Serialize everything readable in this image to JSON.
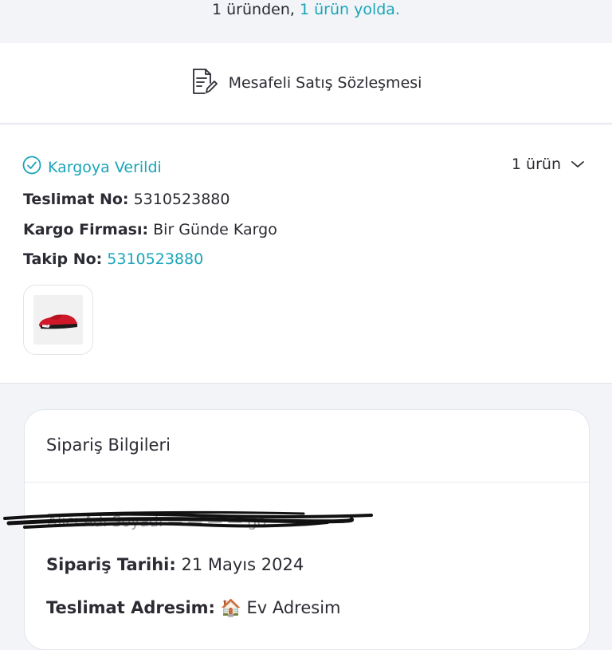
{
  "banner": {
    "count_text": "1 üründen,",
    "status_text": "1 ürün yolda."
  },
  "contract": {
    "label": "Mesafeli Satış Sözleşmesi",
    "icon": "document-edit-icon"
  },
  "shipment": {
    "status": "Kargoya Verildi",
    "status_icon": "check-circle-icon",
    "item_count": "1 ürün",
    "delivery_no_label": "Teslimat No:",
    "delivery_no": "5310523880",
    "carrier_label": "Kargo Firması:",
    "carrier": "Bir Günde Kargo",
    "tracking_label": "Takip No:",
    "tracking_no": "5310523880",
    "product_image": "red-sandal-thumbnail"
  },
  "order": {
    "title": "Sipariş Bilgileri",
    "date_label": "Sipariş Tarihi:",
    "date": "21 Mayıs 2024",
    "address_label": "Teslimat Adresim:",
    "address_icon": "🏠",
    "address": "Ev Adresim"
  },
  "colors": {
    "accent": "#1aa5b8",
    "text": "#2b2b33",
    "background": "#f2f4f8"
  }
}
